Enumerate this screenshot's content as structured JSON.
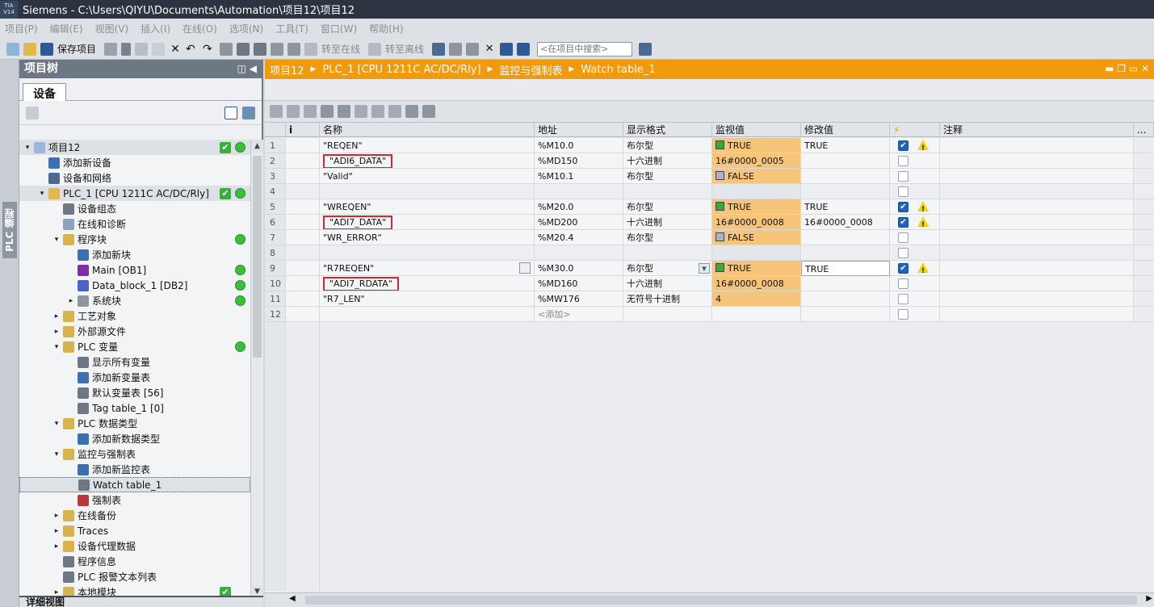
{
  "titlebar": {
    "logo": "TIA V14",
    "text": "Siemens  -  C:\\Users\\QIYU\\Documents\\Automation\\项目12\\项目12"
  },
  "menu": [
    "项目(P)",
    "编辑(E)",
    "视图(V)",
    "插入(I)",
    "在线(O)",
    "选项(N)",
    "工具(T)",
    "窗口(W)",
    "帮助(H)"
  ],
  "toolbar": {
    "save_label": "保存项目",
    "go_online": "转至在线",
    "go_offline": "转至离线",
    "search_placeholder": "<在项目中搜索>"
  },
  "sidetab": {
    "label": "PLC 编程"
  },
  "tree": {
    "title": "项目树",
    "tab": "设备",
    "detail_view": "详细视图",
    "items": [
      {
        "label": "项目12",
        "level": 0,
        "exp": "▾",
        "icon": "project",
        "check": true,
        "dot": true,
        "root": true
      },
      {
        "label": "添加新设备",
        "level": 1,
        "exp": "",
        "icon": "add"
      },
      {
        "label": "设备和网络",
        "level": 1,
        "exp": "",
        "icon": "network"
      },
      {
        "label": "PLC_1 [CPU 1211C AC/DC/Rly]",
        "level": 1,
        "exp": "▾",
        "icon": "plc",
        "check": true,
        "dot": true,
        "root": true
      },
      {
        "label": "设备组态",
        "level": 2,
        "exp": "",
        "icon": "config"
      },
      {
        "label": "在线和诊断",
        "level": 2,
        "exp": "",
        "icon": "diag"
      },
      {
        "label": "程序块",
        "level": 2,
        "exp": "▾",
        "icon": "folder",
        "dot": true
      },
      {
        "label": "添加新块",
        "level": 3,
        "exp": "",
        "icon": "add"
      },
      {
        "label": "Main [OB1]",
        "level": 3,
        "exp": "",
        "icon": "ob",
        "dot": true
      },
      {
        "label": "Data_block_1 [DB2]",
        "level": 3,
        "exp": "",
        "icon": "db",
        "dot": true
      },
      {
        "label": "系统块",
        "level": 3,
        "exp": "▸",
        "icon": "sysblock",
        "dot": true
      },
      {
        "label": "工艺对象",
        "level": 2,
        "exp": "▸",
        "icon": "folder"
      },
      {
        "label": "外部源文件",
        "level": 2,
        "exp": "▸",
        "icon": "folder"
      },
      {
        "label": "PLC 变量",
        "level": 2,
        "exp": "▾",
        "icon": "folder",
        "dot": true
      },
      {
        "label": "显示所有变量",
        "level": 3,
        "exp": "",
        "icon": "tags"
      },
      {
        "label": "添加新变量表",
        "level": 3,
        "exp": "",
        "icon": "add"
      },
      {
        "label": "默认变量表 [56]",
        "level": 3,
        "exp": "",
        "icon": "tagtable"
      },
      {
        "label": "Tag table_1 [0]",
        "level": 3,
        "exp": "",
        "icon": "tagtable"
      },
      {
        "label": "PLC 数据类型",
        "level": 2,
        "exp": "▾",
        "icon": "folder"
      },
      {
        "label": "添加新数据类型",
        "level": 3,
        "exp": "",
        "icon": "add"
      },
      {
        "label": "监控与强制表",
        "level": 2,
        "exp": "▾",
        "icon": "folder"
      },
      {
        "label": "添加新监控表",
        "level": 3,
        "exp": "",
        "icon": "add"
      },
      {
        "label": "Watch table_1",
        "level": 3,
        "exp": "",
        "icon": "watchtable",
        "selected": true
      },
      {
        "label": "强制表",
        "level": 3,
        "exp": "",
        "icon": "forcetable"
      },
      {
        "label": "在线备份",
        "level": 2,
        "exp": "▸",
        "icon": "folder"
      },
      {
        "label": "Traces",
        "level": 2,
        "exp": "▸",
        "icon": "folder"
      },
      {
        "label": "设备代理数据",
        "level": 2,
        "exp": "▸",
        "icon": "folder"
      },
      {
        "label": "程序信息",
        "level": 2,
        "exp": "",
        "icon": "info"
      },
      {
        "label": "PLC 报警文本列表",
        "level": 2,
        "exp": "",
        "icon": "alarm"
      },
      {
        "label": "本地模块",
        "level": 2,
        "exp": "▸",
        "icon": "folder",
        "check": true
      }
    ]
  },
  "breadcrumb": [
    "项目12",
    "PLC_1 [CPU 1211C AC/DC/Rly]",
    "监控与强制表",
    "Watch table_1"
  ],
  "table": {
    "headers": [
      "",
      "i",
      "名称",
      "地址",
      "显示格式",
      "监视值",
      "修改值",
      "⚡",
      "注释",
      "..."
    ],
    "add_label": "<添加>",
    "rows": [
      {
        "n": "1",
        "name": "\"REQEN\"",
        "addr": "%M10.0",
        "fmt": "布尔型",
        "mon": "TRUE",
        "sq": "g",
        "mod": "TRUE",
        "chk": true,
        "warn": true
      },
      {
        "n": "2",
        "name": "\"ADI6_DATA\"",
        "boxed": true,
        "addr": "%MD150",
        "fmt": "十六进制",
        "mon": "16#0000_0005",
        "mod": "",
        "chk": false
      },
      {
        "n": "3",
        "name": "\"Valid\"",
        "addr": "%M10.1",
        "fmt": "布尔型",
        "mon": "FALSE",
        "sq": "b",
        "mod": "",
        "chk": false
      },
      {
        "n": "4",
        "empty": true
      },
      {
        "n": "5",
        "name": "\"WREQEN\"",
        "addr": "%M20.0",
        "fmt": "布尔型",
        "mon": "TRUE",
        "sq": "g",
        "mod": "TRUE",
        "chk": true,
        "warn": true
      },
      {
        "n": "6",
        "name": "\"ADI7_DATA\"",
        "boxed": true,
        "addr": "%MD200",
        "fmt": "十六进制",
        "mon": "16#0000_0008",
        "mod": "16#0000_0008",
        "chk": true,
        "warn": true
      },
      {
        "n": "7",
        "name": "\"WR_ERROR\"",
        "addr": "%M20.4",
        "fmt": "布尔型",
        "mon": "FALSE",
        "sq": "b",
        "mod": "",
        "chk": false
      },
      {
        "n": "8",
        "empty": true
      },
      {
        "n": "9",
        "name": "\"R7REQEN\"",
        "listbtn": true,
        "addr": "%M30.0",
        "fmt": "布尔型",
        "dd": true,
        "mon": "TRUE",
        "sq": "g",
        "mod": "TRUE",
        "modactive": true,
        "chk": true,
        "warn": true
      },
      {
        "n": "10",
        "name": "\"ADI7_RDATA\"",
        "boxed": true,
        "addr": "%MD160",
        "fmt": "十六进制",
        "mon": "16#0000_0008",
        "mod": "",
        "chk": false
      },
      {
        "n": "11",
        "name": "\"R7_LEN\"",
        "addr": "%MW176",
        "fmt": "无符号十进制",
        "mon": "4",
        "mod": "",
        "chk": false
      },
      {
        "n": "12",
        "add": true
      }
    ]
  },
  "colors": {
    "accent": "#f19a0c",
    "monitor_bg": "#f7c57a",
    "highlight_box": "#d9252b",
    "status_green": "#3bbf3b"
  }
}
